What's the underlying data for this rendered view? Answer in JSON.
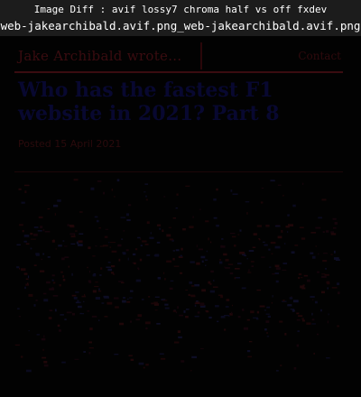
{
  "window": {
    "title_line1": "Image Diff : avif lossy7 chroma half vs off fxdev",
    "title_line2": "web-jakearchibald.avif.png_web-jakearchibald.avif.png"
  },
  "diff_view": {
    "site_name": "Jake Archibald wrote...",
    "nav_link": "Contact",
    "post_title": "Who has the fastest F1 website in 2021? Part 8",
    "post_date": "Posted 15 April 2021"
  },
  "colors": {
    "background": "#000000",
    "titlebar": "#1c1c1c",
    "diff_red": "#3a0c10",
    "diff_blue": "#080830"
  }
}
